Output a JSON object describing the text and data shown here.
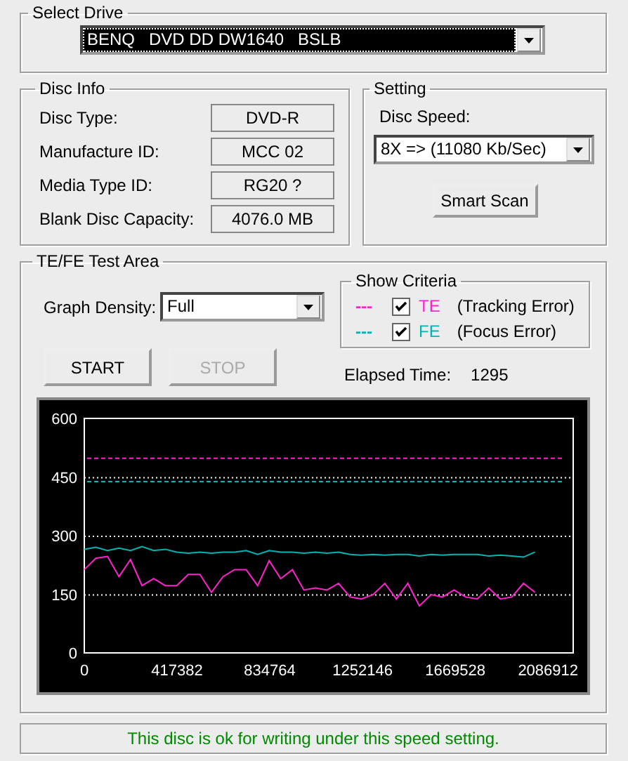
{
  "select_drive": {
    "title": "Select Drive",
    "dropdown": {
      "value": "BENQ   DVD DD DW1640   BSLB",
      "highlighted": true
    }
  },
  "disc_info": {
    "title": "Disc Info",
    "fields": [
      {
        "label": "Disc Type:",
        "value": "DVD-R"
      },
      {
        "label": "Manufacture ID:",
        "value": "MCC 02"
      },
      {
        "label": "Media Type ID:",
        "value": "RG20 ?"
      },
      {
        "label": "Blank Disc Capacity:",
        "value": "4076.0 MB"
      }
    ]
  },
  "setting": {
    "title": "Setting",
    "speed_label": "Disc Speed:",
    "speed": {
      "value": "8X => (11080 Kb/Sec)"
    },
    "smart_scan_button": "Smart Scan"
  },
  "test_area": {
    "title": "TE/FE Test Area",
    "graph_density": {
      "label": "Graph Density:",
      "value": "Full"
    },
    "show_criteria": {
      "title": "Show Criteria",
      "items": [
        {
          "dash": "---",
          "color": "#ff22cc",
          "checked": true,
          "description": "(Tracking Error)"
        },
        {
          "dash": "---",
          "color": "#00b4b4",
          "checked": true,
          "description": "(Focus Error)"
        }
      ]
    },
    "buttons": [
      {
        "label": "START",
        "disabled": false
      },
      {
        "label": "STOP",
        "disabled": true
      }
    ],
    "elapsed_time": {
      "label": "Elapsed Time:",
      "value": "1295"
    },
    "chart_data": {
      "type": "line",
      "x": [
        0,
        52000,
        104000,
        156000,
        208000,
        260000,
        312000,
        364000,
        416000,
        468000,
        520000,
        572000,
        624000,
        676000,
        728000,
        780000,
        832000,
        884000,
        936000,
        988000,
        1040000,
        1092000,
        1144000,
        1196000,
        1248000,
        1300000,
        1352000,
        1404000,
        1456000,
        1508000,
        1560000,
        1612000,
        1664000,
        1716000,
        1768000,
        1820000,
        1872000,
        1924000,
        1976000,
        2028000
      ],
      "series": [
        {
          "name": "TE",
          "color": "#ff22cc",
          "values": [
            213,
            242,
            247,
            195,
            239,
            172,
            190,
            172,
            172,
            201,
            201,
            155,
            195,
            213,
            213,
            172,
            236,
            190,
            213,
            161,
            166,
            161,
            178,
            143,
            138,
            149,
            178,
            138,
            178,
            120,
            149,
            143,
            161,
            143,
            138,
            166,
            138,
            143,
            178,
            155
          ]
        },
        {
          "name": "FE",
          "color": "#00b4b4",
          "values": [
            265,
            270,
            262,
            268,
            262,
            272,
            262,
            265,
            258,
            255,
            258,
            255,
            258,
            258,
            262,
            252,
            262,
            258,
            258,
            255,
            258,
            255,
            258,
            252,
            250,
            252,
            250,
            252,
            252,
            248,
            252,
            250,
            252,
            252,
            252,
            248,
            250,
            248,
            245,
            258
          ]
        }
      ],
      "xlim": [
        0,
        2200000
      ],
      "ylim": [
        0,
        600
      ],
      "grid": true,
      "xticks": [
        0,
        417382,
        834764,
        1252146,
        1669528,
        2086912
      ],
      "yticks": [
        0,
        150,
        300,
        450,
        600
      ],
      "ref_lines": [
        {
          "axis": "y",
          "value": 500,
          "color": "#ff22cc"
        },
        {
          "axis": "y",
          "value": 440,
          "color": "#00b4b4"
        }
      ]
    }
  },
  "status_bar": {
    "text": "This disc is ok for writing under this speed setting."
  }
}
